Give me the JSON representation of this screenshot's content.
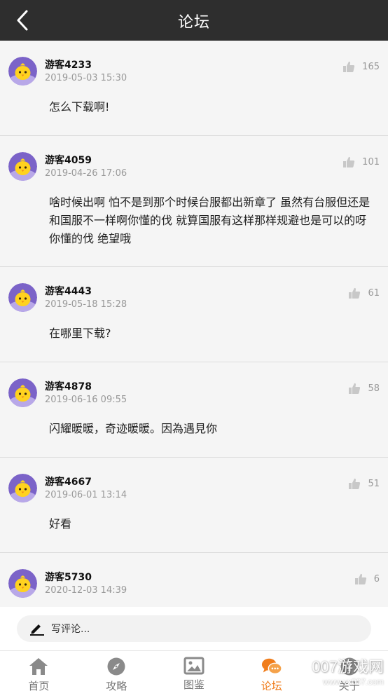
{
  "header": {
    "title": "论坛"
  },
  "posts": [
    {
      "user": "游客4233",
      "date": "2019-05-03 15:30",
      "likes": "165",
      "text": "怎么下载啊!"
    },
    {
      "user": "游客4059",
      "date": "2019-04-26 17:06",
      "likes": "101",
      "text": "啥时候出啊 怕不是到那个时候台服都出新章了 虽然有台服但还是和国服不一样啊你懂的伐 就算国服有这样那样规避也是可以的呀 你懂的伐 绝望哦"
    },
    {
      "user": "游客4443",
      "date": "2019-05-18 15:28",
      "likes": "61",
      "text": "在哪里下载?"
    },
    {
      "user": "游客4878",
      "date": "2019-06-16 09:55",
      "likes": "58",
      "text": "闪耀暖暖，奇迹暖暖。因為遇見你"
    },
    {
      "user": "游客4667",
      "date": "2019-06-01 13:14",
      "likes": "51",
      "text": "好看"
    },
    {
      "user": "游客5730",
      "date": "2020-12-03 14:39",
      "likes": "6",
      "text": ""
    }
  ],
  "comment": {
    "placeholder": "写评论..."
  },
  "nav": {
    "items": [
      {
        "label": "首页",
        "icon": "home-icon"
      },
      {
        "label": "攻略",
        "icon": "compass-icon"
      },
      {
        "label": "图鉴",
        "icon": "image-icon"
      },
      {
        "label": "论坛",
        "icon": "chat-bubbles-icon"
      },
      {
        "label": "关于",
        "icon": "info-icon"
      }
    ],
    "active_index": 3
  },
  "watermark": {
    "main": "007游戏网",
    "sub": "www.yx007.com"
  },
  "colors": {
    "header_bg": "#2e2e2e",
    "active": "#f07d1c",
    "avatar_bg": "#7b63c8"
  }
}
